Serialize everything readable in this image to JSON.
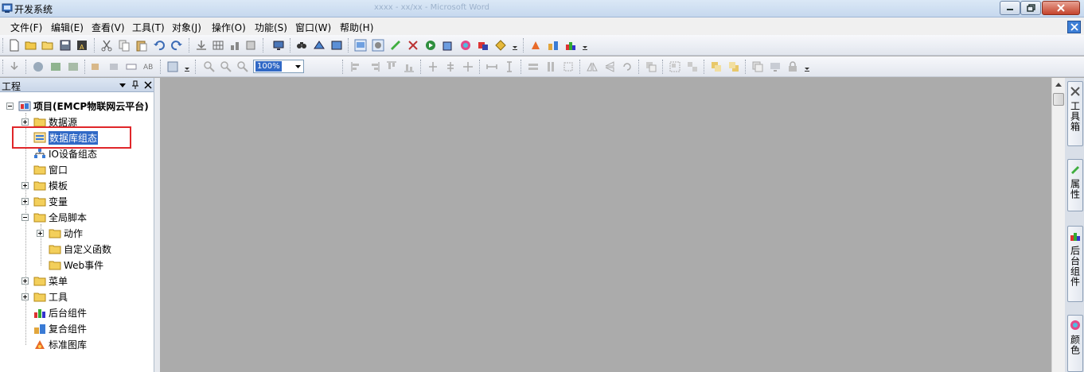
{
  "window": {
    "title": "开发系统",
    "blurred_title": "xxxx - xx/xx - Microsoft Word"
  },
  "menu": {
    "items": [
      "文件(F)",
      "编辑(E)",
      "查看(V)",
      "工具(T)",
      "对象(J)",
      "操作(O)",
      "功能(S)",
      "窗口(W)",
      "帮助(H)"
    ]
  },
  "toolbar": {
    "zoom_value": "100%"
  },
  "project_panel": {
    "title": "工程",
    "tree": [
      {
        "label": "项目(EMCP物联网云平台)",
        "level": 0,
        "expander": "minus",
        "icon": "project-icon"
      },
      {
        "label": "数据源",
        "level": 1,
        "expander": "plus",
        "icon": "folder-icon"
      },
      {
        "label": "数据库组态",
        "level": 1,
        "expander": "none",
        "icon": "database-icon",
        "selected": true
      },
      {
        "label": "IO设备组态",
        "level": 1,
        "expander": "none",
        "icon": "network-icon"
      },
      {
        "label": "窗口",
        "level": 1,
        "expander": "none",
        "icon": "folder-icon"
      },
      {
        "label": "模板",
        "level": 1,
        "expander": "plus",
        "icon": "folder-icon"
      },
      {
        "label": "变量",
        "level": 1,
        "expander": "plus",
        "icon": "folder-icon"
      },
      {
        "label": "全局脚本",
        "level": 1,
        "expander": "minus",
        "icon": "folder-icon"
      },
      {
        "label": "动作",
        "level": 2,
        "expander": "plus",
        "icon": "folder-icon"
      },
      {
        "label": "自定义函数",
        "level": 2,
        "expander": "none",
        "icon": "folder-icon"
      },
      {
        "label": "Web事件",
        "level": 2,
        "expander": "none",
        "icon": "folder-icon"
      },
      {
        "label": "菜单",
        "level": 1,
        "expander": "plus",
        "icon": "folder-icon"
      },
      {
        "label": "工具",
        "level": 1,
        "expander": "plus",
        "icon": "folder-icon"
      },
      {
        "label": "后台组件",
        "level": 1,
        "expander": "none",
        "icon": "bar-chart-icon"
      },
      {
        "label": "复合组件",
        "level": 1,
        "expander": "none",
        "icon": "composite-icon"
      },
      {
        "label": "标准图库",
        "level": 1,
        "expander": "none",
        "icon": "gallery-icon"
      }
    ]
  },
  "right_dock": {
    "tabs": [
      "工具箱",
      "属性",
      "后台组件",
      "颜色"
    ]
  },
  "colors": {
    "selection": "#3169c6",
    "highlight_box": "#e0262a",
    "canvas": "#ababab"
  }
}
